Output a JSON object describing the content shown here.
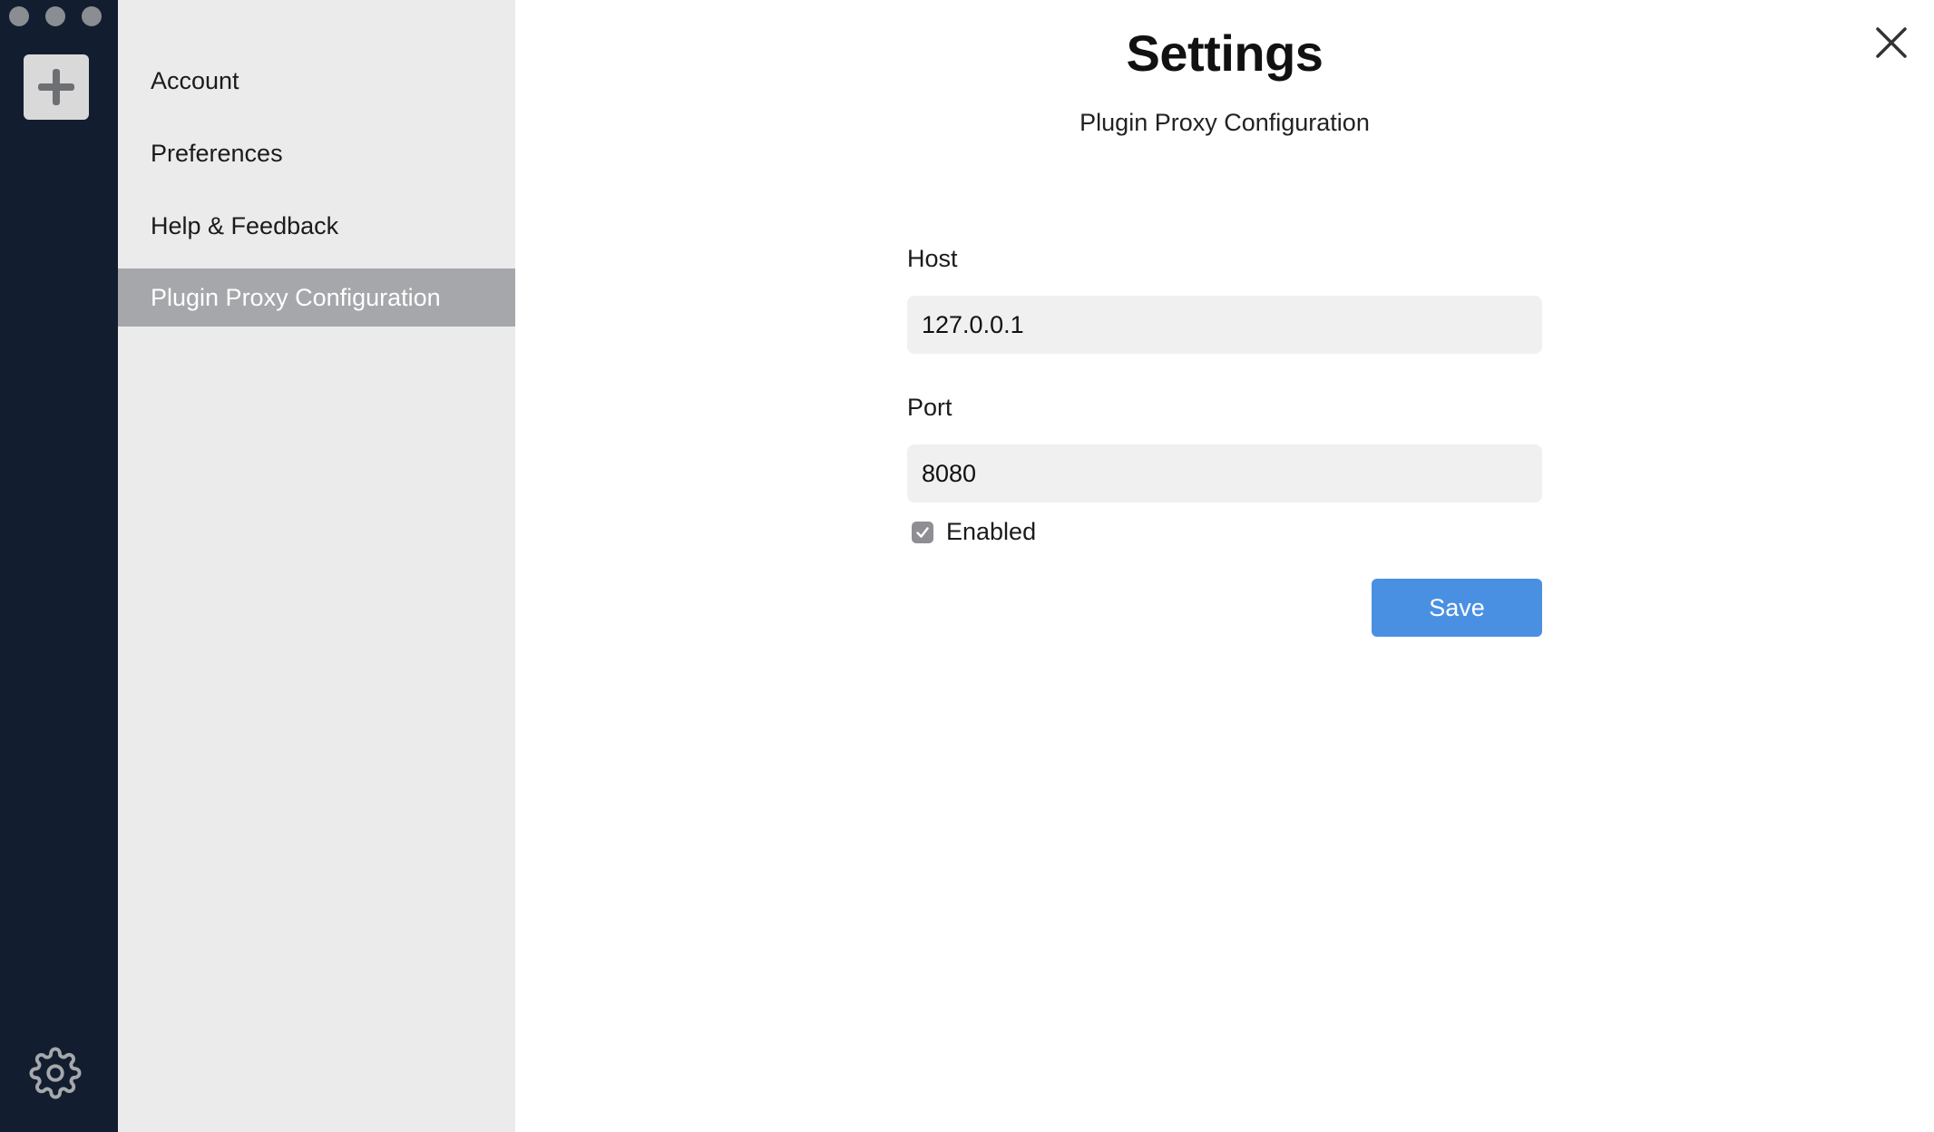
{
  "window": {
    "traffic_lights": [
      "close",
      "minimize",
      "zoom"
    ]
  },
  "rail": {
    "add_icon": "plus-icon",
    "settings_icon": "gear-icon"
  },
  "menu": {
    "items": [
      {
        "label": "Account",
        "active": false
      },
      {
        "label": "Preferences",
        "active": false
      },
      {
        "label": "Help & Feedback",
        "active": false
      },
      {
        "label": "Plugin Proxy Configuration",
        "active": true
      }
    ]
  },
  "main": {
    "title": "Settings",
    "subtitle": "Plugin Proxy Configuration",
    "close_icon": "close-icon",
    "host": {
      "label": "Host",
      "value": "127.0.0.1"
    },
    "port": {
      "label": "Port",
      "value": "8080"
    },
    "enabled": {
      "label": "Enabled",
      "checked": true
    },
    "save_label": "Save"
  },
  "colors": {
    "rail_bg": "#121e2f",
    "menu_bg": "#ebebeb",
    "active_item_bg": "#a6a7aa",
    "save_button": "#4a90e2"
  }
}
